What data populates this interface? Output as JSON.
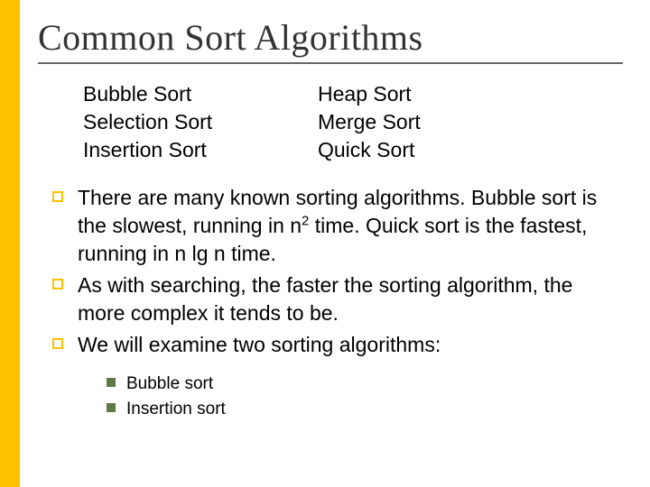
{
  "title": "Common Sort Algorithms",
  "columns": {
    "left": [
      "Bubble Sort",
      "Selection Sort",
      "Insertion Sort"
    ],
    "right": [
      "Heap Sort",
      "Merge Sort",
      "Quick Sort"
    ]
  },
  "bullets": [
    {
      "pre": "There are many known sorting algorithms.   Bubble sort is the slowest, running in  n",
      "sup": "2",
      "post": " time.  Quick sort is the fastest, running in  n lg n  time."
    },
    {
      "text": "As with searching, the faster the sorting algorithm, the more complex it tends to be."
    },
    {
      "text": "We will examine two sorting algorithms:"
    }
  ],
  "subbullets": [
    "Bubble sort",
    "Insertion sort"
  ]
}
